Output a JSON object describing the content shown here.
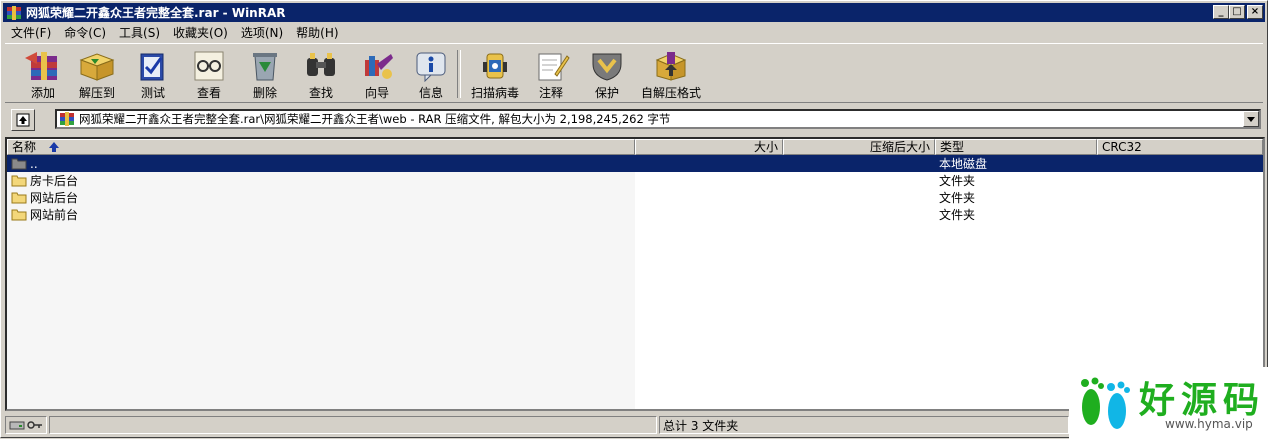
{
  "window": {
    "title": "网狐荣耀二开鑫众王者完整全套.rar - WinRAR",
    "controls": [
      "_",
      "□",
      "×"
    ]
  },
  "menu": [
    "文件(F)",
    "命令(C)",
    "工具(S)",
    "收藏夹(O)",
    "选项(N)",
    "帮助(H)"
  ],
  "toolbar": [
    {
      "label": "添加",
      "icon": "add-archive-icon"
    },
    {
      "label": "解压到",
      "icon": "extract-to-icon"
    },
    {
      "label": "测试",
      "icon": "test-icon"
    },
    {
      "label": "查看",
      "icon": "view-icon"
    },
    {
      "label": "删除",
      "icon": "delete-icon"
    },
    {
      "label": "查找",
      "icon": "find-icon"
    },
    {
      "label": "向导",
      "icon": "wizard-icon"
    },
    {
      "label": "信息",
      "icon": "info-icon"
    },
    {
      "label": "扫描病毒",
      "icon": "virus-scan-icon"
    },
    {
      "label": "注释",
      "icon": "comment-icon"
    },
    {
      "label": "保护",
      "icon": "protect-icon"
    },
    {
      "label": "自解压格式",
      "icon": "sfx-icon"
    }
  ],
  "address": {
    "path": "网狐荣耀二开鑫众王者完整全套.rar\\网狐荣耀二开鑫众王者\\web - RAR 压缩文件, 解包大小为 2,198,245,262 字节"
  },
  "columns": {
    "name": "名称",
    "size": "大小",
    "packed": "压缩后大小",
    "type": "类型",
    "crc": "CRC32"
  },
  "rows": [
    {
      "name": "..",
      "type": "本地磁盘",
      "selected": true
    },
    {
      "name": "房卡后台",
      "type": "文件夹",
      "selected": false
    },
    {
      "name": "网站后台",
      "type": "文件夹",
      "selected": false
    },
    {
      "name": "网站前台",
      "type": "文件夹",
      "selected": false
    }
  ],
  "status": {
    "summary": "总计 3 文件夹"
  },
  "watermark": {
    "text": "好源码",
    "url": "www.hyma.vip",
    "colors": {
      "green": "#1fae1f",
      "cyan": "#11b6e6"
    }
  }
}
